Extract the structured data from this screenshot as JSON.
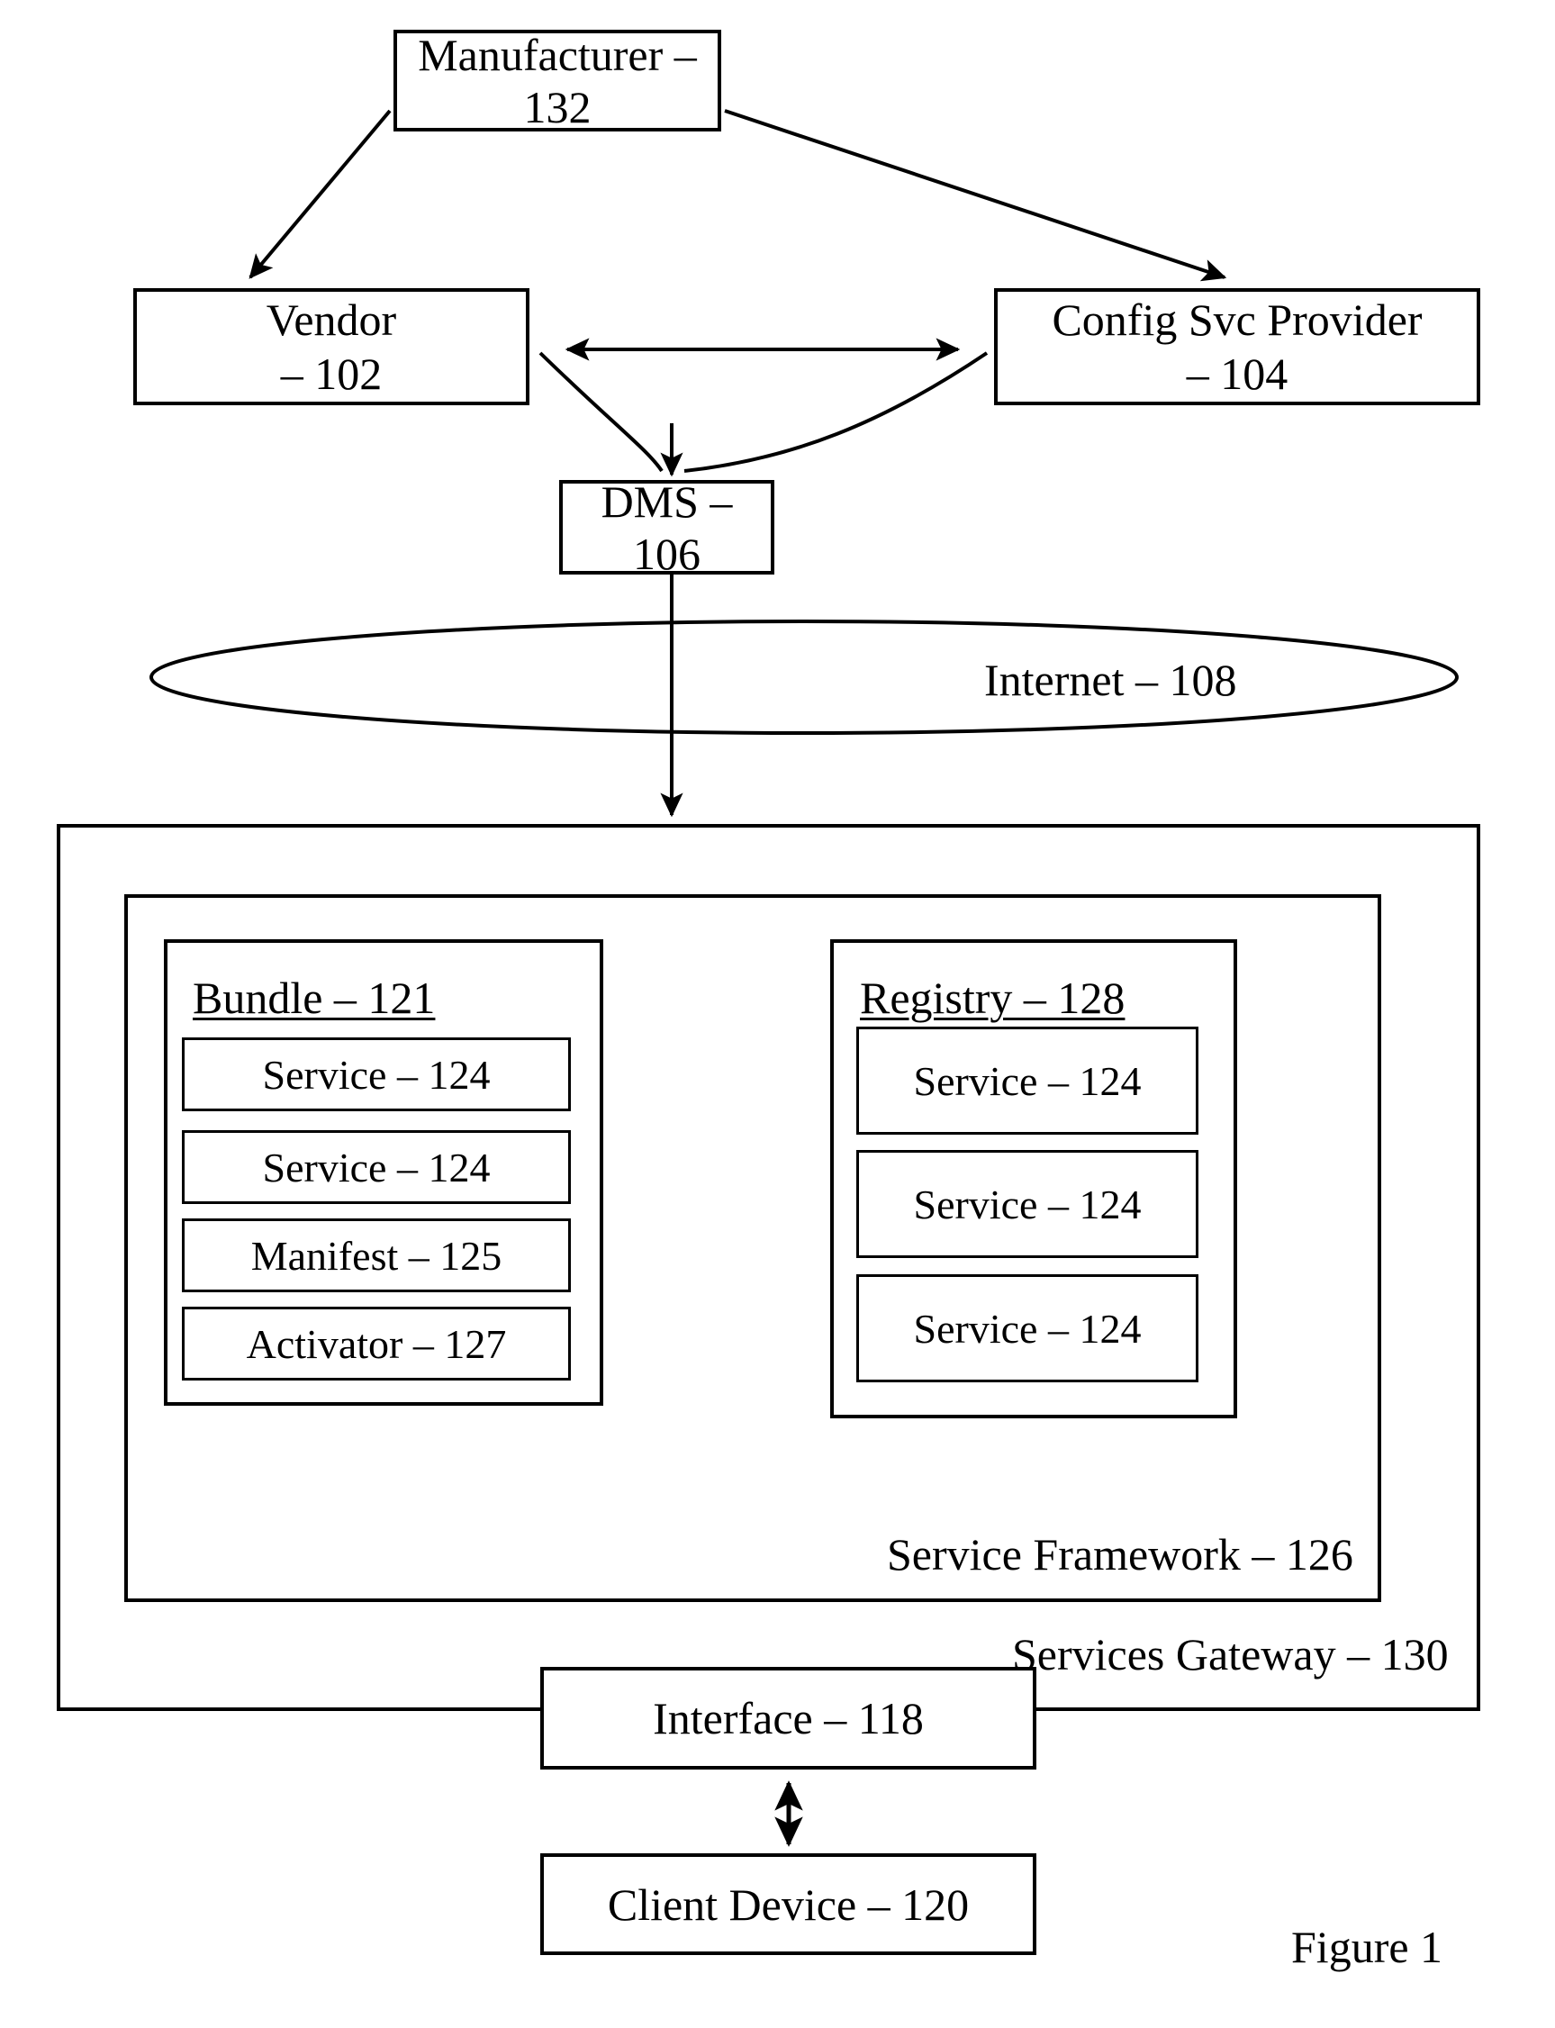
{
  "figure": {
    "caption": "Figure 1"
  },
  "nodes": {
    "manufacturer": {
      "label": "Manufacturer – 132"
    },
    "vendor": {
      "label_line1": "Vendor",
      "label_line2": "– 102"
    },
    "config_svc_provider": {
      "label_line1": "Config Svc Provider",
      "label_line2": "– 104"
    },
    "dms": {
      "label": "DMS – 106"
    },
    "internet": {
      "label": "Internet – 108"
    },
    "services_gateway": {
      "label": "Services Gateway – 130"
    },
    "service_framework": {
      "label": "Service Framework – 126"
    },
    "bundle": {
      "label": "Bundle – 121"
    },
    "registry": {
      "label": "Registry – 128"
    },
    "interface": {
      "label": "Interface – 118"
    },
    "client_device": {
      "label": "Client Device – 120"
    }
  },
  "bundle_items": [
    {
      "label": "Service – 124"
    },
    {
      "label": "Service – 124"
    },
    {
      "label": "Manifest – 125"
    },
    {
      "label": "Activator – 127"
    }
  ],
  "registry_items": [
    {
      "label": "Service – 124"
    },
    {
      "label": "Service – 124"
    },
    {
      "label": "Service – 124"
    }
  ],
  "colors": {
    "stroke": "#000000",
    "background": "#ffffff"
  }
}
